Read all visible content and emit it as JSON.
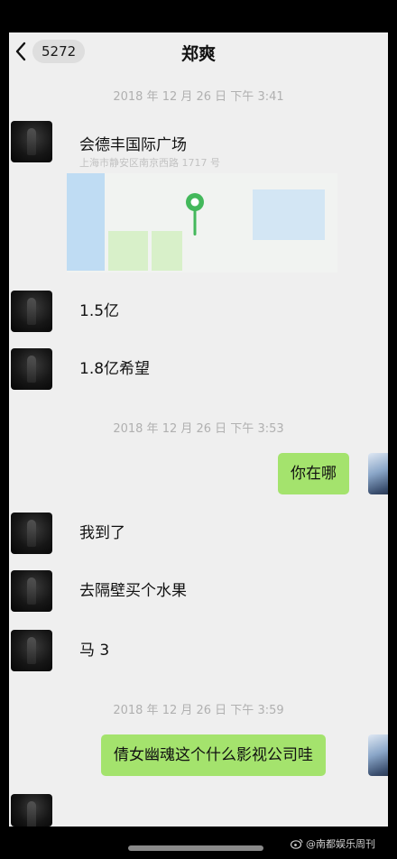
{
  "header": {
    "back_count": "5272",
    "title": "郑爽"
  },
  "messages": {
    "ts1": "2018 年 12 月 26 日 下午 3:41",
    "location": {
      "title": "会德丰国际广场",
      "address": "上海市静安区南京西路 1717 号"
    },
    "m1": "1.5亿",
    "m2": "1.8亿希望",
    "ts2": "2018 年 12 月 26 日 下午 3:53",
    "m3": "你在哪",
    "m4": "我到了",
    "m5": "去隔壁买个水果",
    "m6": "马 3",
    "ts3": "2018 年 12 月 26 日 下午 3:59",
    "m7": "倩女幽魂这个什么影视公司哇"
  },
  "watermark": "@南都娱乐周刊",
  "colors": {
    "background": "#efefef",
    "outgoing_bubble": "#a4e36d",
    "map_pin": "#43b85b"
  },
  "icons": {
    "back": "chevron-left-icon",
    "pin": "map-pin-icon",
    "weibo": "weibo-icon"
  }
}
